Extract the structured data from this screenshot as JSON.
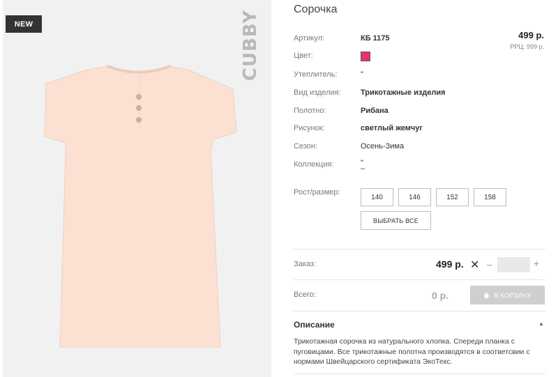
{
  "photo": {
    "badge": "NEW",
    "brand": "CUBBY",
    "garment_color": "#fce1d3",
    "button_color": "#c9b19a"
  },
  "product": {
    "title": "Сорочка",
    "price": "499 р.",
    "rrp": "РРЦ: 999 р."
  },
  "attributes": {
    "article": {
      "label": "Артикул:",
      "value": "КБ 1175"
    },
    "color": {
      "label": "Цвет:",
      "swatch": "#e8336f"
    },
    "insulation": {
      "label": "Утеплитель:",
      "value": "\""
    },
    "product_type": {
      "label": "Вид изделия:",
      "value": "Трикотажные изделия"
    },
    "fabric": {
      "label": "Полотно:",
      "value": "Рибана"
    },
    "pattern": {
      "label": "Рисунок:",
      "value": "светлый жемчуг"
    },
    "season": {
      "label": "Сезон:",
      "value": "Осень-Зима"
    },
    "collection": {
      "label": "Коллекция:",
      "value_line1": "\"",
      "value_line2": "–"
    }
  },
  "sizes": {
    "label": "Рост/размер:",
    "options": [
      "140",
      "146",
      "152",
      "158"
    ],
    "select_all": "ВЫБРАТЬ ВСЕ"
  },
  "order": {
    "label": "Заказ:",
    "price": "499 р.",
    "times": "✕",
    "minus": "–",
    "quantity": "",
    "plus": "+"
  },
  "total": {
    "label": "Всего:",
    "value": "0 р.",
    "cart_button": "В КОРЗИНУ"
  },
  "description": {
    "title": "Описание",
    "text": "Трикотажная сорочка из натурального хлопка. Спереди планка с пуговицами. Все трикотажные полотна производятся в соответсвии с нормами Швейцарского сертификата ЭкоТекс."
  }
}
